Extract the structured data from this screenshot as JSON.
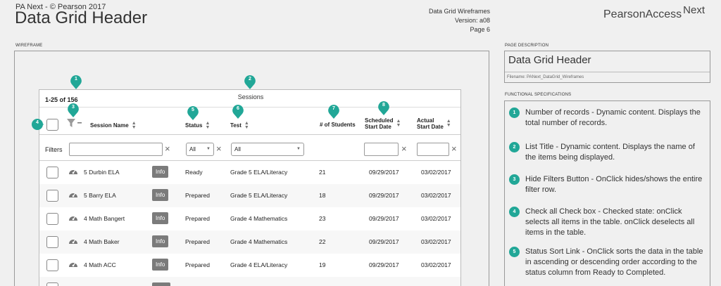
{
  "header": {
    "company": "PA Next - © Pearson 2017",
    "title": "Data Grid Header",
    "meta": [
      "Data Grid Wireframes",
      "Version:  a08",
      "Page 6"
    ],
    "brand": "PearsonAccess",
    "brand_sup": "Next"
  },
  "wireframe_label": "WIREFRAME",
  "page_description_label": "PAGE DESCRIPTION",
  "page_description": {
    "title": "Data Grid Header",
    "filename": "Filename: PANext_DataGrid_Wireframes"
  },
  "functional_label": "FUNCTIONAL SPECIFICATIONS",
  "specs": [
    {
      "num": "1",
      "text": "Number of records - Dynamic content. Displays the total number of records."
    },
    {
      "num": "2",
      "text": "List Title - Dynamic content. Displays the name of the items being displayed."
    },
    {
      "num": "3",
      "text": "Hide Filters Button - OnClick hides/shows the entire filter row."
    },
    {
      "num": "4",
      "text": "Check all Check box - Checked state: onClick selects all items in the table. onClick deselects all items in the table."
    },
    {
      "num": "5",
      "text": "Status Sort Link - OnClick sorts the data in the table in ascending or descending order according to the status column from  Ready to Completed."
    }
  ],
  "grid": {
    "count": "1-25 of 156",
    "list_title": "Sessions",
    "columns": {
      "session_name": "Session Name",
      "status": "Status",
      "test": "Test",
      "students": "# of Students",
      "sched_1": "Scheduled",
      "sched_2": "Start Date",
      "actual_1": "Actual",
      "actual_2": "Start Date"
    },
    "filters_label": "Filters",
    "status_filter": "All",
    "test_filter": "All",
    "info_label": "Info",
    "rows": [
      {
        "name": "5 Durbin ELA",
        "status": "Ready",
        "test": "Grade 5 ELA/Literacy",
        "students": "21",
        "scheduled": "09/29/2017",
        "actual": "03/02/2017"
      },
      {
        "name": "5 Barry ELA",
        "status": "Prepared",
        "test": "Grade 5 ELA/Literacy",
        "students": "18",
        "scheduled": "09/29/2017",
        "actual": "03/02/2017"
      },
      {
        "name": "4 Math Bangert",
        "status": "Prepared",
        "test": "Grade 4 Mathematics",
        "students": "23",
        "scheduled": "09/29/2017",
        "actual": "03/02/2017"
      },
      {
        "name": "4 Math Baker",
        "status": "Prepared",
        "test": "Grade 4 Mathematics",
        "students": "22",
        "scheduled": "09/29/2017",
        "actual": "03/02/2017"
      },
      {
        "name": "4 Math ACC",
        "status": "Prepared",
        "test": "Grade 4 ELA/Literacy",
        "students": "19",
        "scheduled": "09/29/2017",
        "actual": "03/02/2017"
      }
    ]
  },
  "badges": [
    "1",
    "2",
    "3",
    "4",
    "5",
    "6",
    "7",
    "8"
  ],
  "colors": {
    "badge": "#21a797",
    "info": "#7b7b7b"
  }
}
